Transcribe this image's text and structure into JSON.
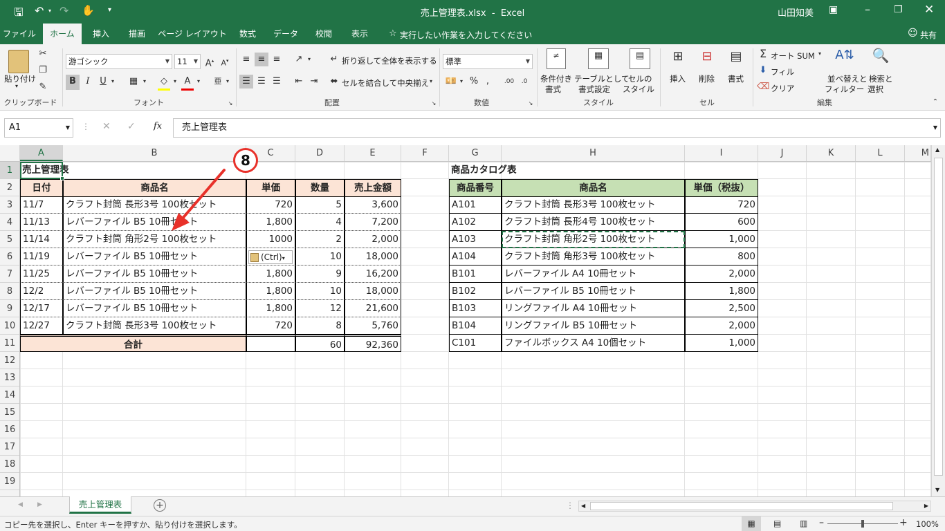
{
  "titlebar": {
    "title": "売上管理表.xlsx  -  Excel",
    "user": "山田知美"
  },
  "tabs": [
    "ファイル",
    "ホーム",
    "挿入",
    "描画",
    "ページ レイアウト",
    "数式",
    "データ",
    "校閲",
    "表示"
  ],
  "tell_me": "実行したい作業を入力してください",
  "share": "共有",
  "ribbon": {
    "paste": "貼り付け",
    "clipboard": "クリップボード",
    "font_name": "游ゴシック",
    "font_size": "11",
    "font": "フォント",
    "wrap_text": "折り返して全体を表示する",
    "merge_center": "セルを結合して中央揃え",
    "alignment": "配置",
    "number_format": "標準",
    "number": "数値",
    "cond_format": [
      "条件付き",
      "書式"
    ],
    "format_table": [
      "テーブルとして",
      "書式設定"
    ],
    "cell_styles": [
      "セルの",
      "スタイル"
    ],
    "styles": "スタイル",
    "insert": "挿入",
    "delete": "削除",
    "format": "書式",
    "cells": "セル",
    "autosum": "オート SUM",
    "fill": "フィル",
    "clear": "クリア",
    "sort_filter": [
      "並べ替えと",
      "フィルター"
    ],
    "find_select": [
      "検索と",
      "選択"
    ],
    "editing": "編集"
  },
  "formula_bar": {
    "name_box": "A1",
    "content": "売上管理表"
  },
  "columns": [
    "A",
    "B",
    "C",
    "D",
    "E",
    "F",
    "G",
    "H",
    "I",
    "J",
    "K",
    "L",
    "M"
  ],
  "rows": [
    "1",
    "2",
    "3",
    "4",
    "5",
    "6",
    "7",
    "8",
    "9",
    "10",
    "11",
    "12",
    "13",
    "14",
    "15",
    "16",
    "17",
    "18",
    "19"
  ],
  "sales_table": {
    "title": "売上管理表",
    "headers": [
      "日付",
      "商品名",
      "単価",
      "数量",
      "売上金額"
    ],
    "rows": [
      [
        "11/7",
        "クラフト封筒 長形3号 100枚セット",
        "720",
        "5",
        "3,600"
      ],
      [
        "11/13",
        "レバーファイル B5 10冊セット",
        "1,800",
        "4",
        "7,200"
      ],
      [
        "11/14",
        "クラフト封筒 角形2号 100枚セット",
        "1000",
        "2",
        "2,000"
      ],
      [
        "11/19",
        "レバーファイル B5 10冊セット",
        "",
        "10",
        "18,000"
      ],
      [
        "11/25",
        "レバーファイル B5 10冊セット",
        "1,800",
        "9",
        "16,200"
      ],
      [
        "12/2",
        "レバーファイル B5 10冊セット",
        "1,800",
        "10",
        "18,000"
      ],
      [
        "12/17",
        "レバーファイル B5 10冊セット",
        "1,800",
        "12",
        "21,600"
      ],
      [
        "12/27",
        "クラフト封筒 長形3号 100枚セット",
        "720",
        "8",
        "5,760"
      ]
    ],
    "total_label": "合計",
    "total_qty": "60",
    "total_amount": "92,360"
  },
  "catalog_table": {
    "title": "商品カタログ表",
    "headers": [
      "商品番号",
      "商品名",
      "単価（税抜）"
    ],
    "rows": [
      [
        "A101",
        "クラフト封筒 長形3号 100枚セット",
        "720"
      ],
      [
        "A102",
        "クラフト封筒 長形4号 100枚セット",
        "600"
      ],
      [
        "A103",
        "クラフト封筒 角形2号 100枚セット",
        "1,000"
      ],
      [
        "A104",
        "クラフト封筒 角形3号 100枚セット",
        "800"
      ],
      [
        "B101",
        "レバーファイル A4 10冊セット",
        "2,000"
      ],
      [
        "B102",
        "レバーファイル B5 10冊セット",
        "1,800"
      ],
      [
        "B103",
        "リングファイル A4 10冊セット",
        "2,500"
      ],
      [
        "B104",
        "リングファイル B5 10冊セット",
        "2,000"
      ],
      [
        "C101",
        "ファイルボックス A4 10個セット",
        "1,000"
      ]
    ]
  },
  "paste_options": "(Ctrl)",
  "annotation": "8",
  "sheet_tab": "売上管理表",
  "status": {
    "message": "コピー先を選択し、Enter キーを押すか、貼り付けを選択します。",
    "zoom": "100%"
  },
  "colors": {
    "excel_green": "#217346",
    "peach": "#fce4d6",
    "green_header": "#c6e0b4",
    "annotation_red": "#e8312a"
  }
}
